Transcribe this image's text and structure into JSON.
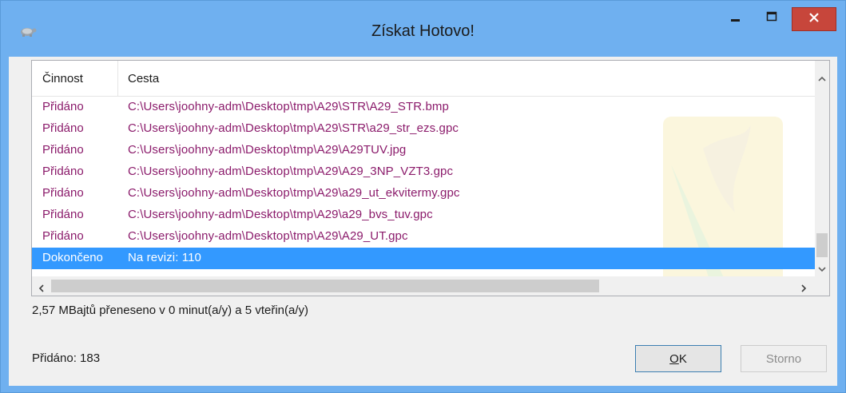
{
  "window": {
    "title": "Získat Hotovo!",
    "accent": "#6fb0f0",
    "close_color": "#c7463b"
  },
  "icons": {
    "app": "tortoise-icon",
    "minimize": "minimize-icon",
    "maximize": "maximize-icon",
    "close": "close-icon",
    "scroll_up": "chevron-up-icon",
    "scroll_down": "chevron-down-icon",
    "scroll_left": "chevron-left-icon",
    "scroll_right": "chevron-right-icon"
  },
  "list": {
    "columns": [
      "Činnost",
      "Cesta"
    ],
    "rows": [
      {
        "action": "Přidáno",
        "path": "C:\\Users\\joohny-adm\\Desktop\\tmp\\A29\\STR\\A29_STR.bmp"
      },
      {
        "action": "Přidáno",
        "path": "C:\\Users\\joohny-adm\\Desktop\\tmp\\A29\\STR\\a29_str_ezs.gpc"
      },
      {
        "action": "Přidáno",
        "path": "C:\\Users\\joohny-adm\\Desktop\\tmp\\A29\\A29TUV.jpg"
      },
      {
        "action": "Přidáno",
        "path": "C:\\Users\\joohny-adm\\Desktop\\tmp\\A29\\A29_3NP_VZT3.gpc"
      },
      {
        "action": "Přidáno",
        "path": "C:\\Users\\joohny-adm\\Desktop\\tmp\\A29\\a29_ut_ekvitermy.gpc"
      },
      {
        "action": "Přidáno",
        "path": "C:\\Users\\joohny-adm\\Desktop\\tmp\\A29\\a29_bvs_tuv.gpc"
      },
      {
        "action": "Přidáno",
        "path": "C:\\Users\\joohny-adm\\Desktop\\tmp\\A29\\A29_UT.gpc"
      },
      {
        "action": "Dokončeno",
        "path": "Na revizi: 110",
        "selected": true
      }
    ]
  },
  "status": {
    "transfer": "2,57 MBajtů přeneseno v 0 minut(a/y) a 5 vteřin(a/y)",
    "added": "Přidáno: 183"
  },
  "buttons": {
    "ok_prefix": "",
    "ok_underline": "O",
    "ok_suffix": "K",
    "cancel": "Storno"
  }
}
